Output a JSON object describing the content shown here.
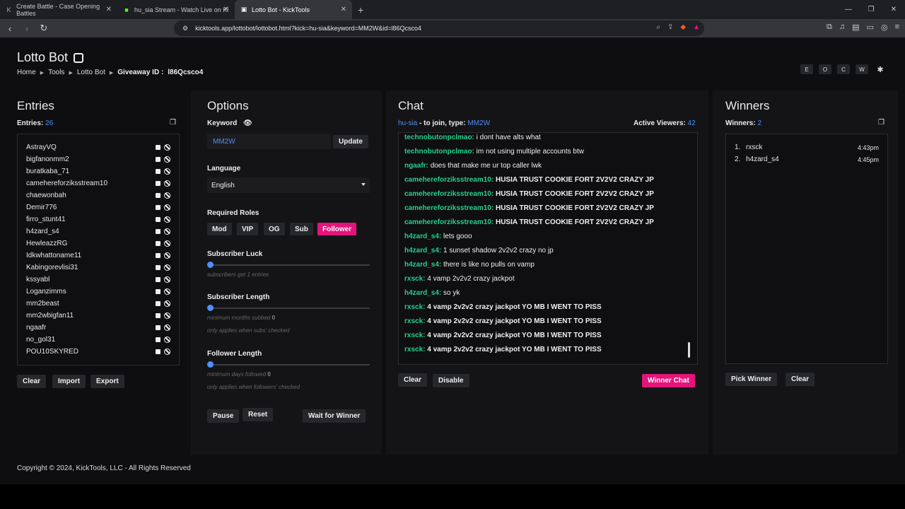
{
  "browser": {
    "tabs": [
      {
        "title": "Create Battle - Case Opening Battles",
        "icon": "k-logo-icon"
      },
      {
        "title": "hu_sia Stream - Watch Live on Ki",
        "icon": "kick-logo-icon"
      },
      {
        "title": "Lotto Bot - KickTools",
        "icon": "page-icon"
      }
    ],
    "url": "kicktools.app/lottobot/lottobot.html?kick=hu-sia&keyword=MM2W&id=l86Qcsco4"
  },
  "header": {
    "title": "Lotto Bot",
    "breadcrumb": [
      "Home",
      "Tools",
      "Lotto Bot"
    ],
    "giveaway_label": "Giveaway ID :",
    "giveaway_id": "l86Qcsco4",
    "theme_buttons": [
      "E",
      "O",
      "C",
      "W",
      "✱"
    ]
  },
  "entries": {
    "heading": "Entries",
    "count_label": "Entries:",
    "count": "26",
    "names": [
      "AstrayVQ",
      "bigfanonmm2",
      "buratkaba_71",
      "camehereforziksstream10",
      "chaewonbah",
      "Demir776",
      "firro_stunt41",
      "h4zard_s4",
      "HewleazzRG",
      "Idkwhattoname11",
      "Kabingorevlisi31",
      "kssyabl",
      "Loganzimms",
      "mm2beast",
      "mm2wbigfan11",
      "ngaafr",
      "no_gol31",
      "POU10SKYRED"
    ],
    "buttons": {
      "clear": "Clear",
      "import": "Import",
      "export": "Export"
    }
  },
  "options": {
    "heading": "Options",
    "keyword_label": "Keyword",
    "keyword_value": "MM2W",
    "update": "Update",
    "language_label": "Language",
    "language_value": "English",
    "roles_label": "Required Roles",
    "roles": [
      "Mod",
      "VIP",
      "OG",
      "Sub",
      "Follower"
    ],
    "sub_luck_label": "Subscriber Luck",
    "sub_luck_hint": "subscribers get 1 entries",
    "sub_length_label": "Subscriber Length",
    "sub_length_hint": "minimum months subbed",
    "sub_length_value": "0",
    "sub_length_hint2": "only applies when subs' checked",
    "follower_length_label": "Follower Length",
    "follower_length_hint": "minimum days followed",
    "follower_length_value": "0",
    "follower_length_hint2": "only applies when followers' checked",
    "pause": "Pause",
    "reset": "Reset",
    "wait": "Wait for Winner"
  },
  "chat": {
    "heading": "Chat",
    "channel": "hu-sia",
    "join_text": "- to join, type:",
    "keyword": "MM2W",
    "viewers_label": "Active Viewers:",
    "viewers": "42",
    "messages": [
      {
        "user": "technobutonpclmao:",
        "text": "i dont have alts what",
        "bold": false
      },
      {
        "user": "technobutonpclmao:",
        "text": "im not using multiple accounts btw",
        "bold": false
      },
      {
        "user": "ngaafr:",
        "text": "does that make me ur top caller lwk",
        "bold": false
      },
      {
        "user": "camehereforziksstream10:",
        "text": "HUSIA TRUST COOKIE FORT 2V2V2 CRAZY JP",
        "bold": true
      },
      {
        "user": "camehereforziksstream10:",
        "text": "HUSIA TRUST COOKIE FORT 2V2V2 CRAZY JP",
        "bold": true
      },
      {
        "user": "camehereforziksstream10:",
        "text": "HUSIA TRUST COOKIE FORT 2V2V2 CRAZY JP",
        "bold": true
      },
      {
        "user": "camehereforziksstream10:",
        "text": "HUSIA TRUST COOKIE FORT 2V2V2 CRAZY JP",
        "bold": true
      },
      {
        "user": "h4zard_s4:",
        "text": "lets gooo",
        "bold": false
      },
      {
        "user": "h4zard_s4:",
        "text": "1 sunset shadow 2v2v2 crazy no jp",
        "bold": false
      },
      {
        "user": "h4zard_s4:",
        "text": "there is like no pulls on vamp",
        "bold": false
      },
      {
        "user": "rxsck:",
        "text": "4 vamp 2v2v2 crazy jackpot",
        "bold": false
      },
      {
        "user": "h4zard_s4:",
        "text": "so yk",
        "bold": false
      },
      {
        "user": "rxsck:",
        "text": "4 vamp 2v2v2 crazy jackpot YO MB I WENT TO PISS",
        "bold": true
      },
      {
        "user": "rxsck:",
        "text": "4 vamp 2v2v2 crazy jackpot YO MB I WENT TO PISS",
        "bold": true
      },
      {
        "user": "rxsck:",
        "text": "4 vamp 2v2v2 crazy jackpot YO MB I WENT TO PISS",
        "bold": true
      },
      {
        "user": "rxsck:",
        "text": "4 vamp 2v2v2 crazy jackpot YO MB I WENT TO PISS",
        "bold": true
      }
    ],
    "clear": "Clear",
    "disable": "Disable",
    "winner_chat": "Winner Chat"
  },
  "winners": {
    "heading": "Winners",
    "count_label": "Winners:",
    "count": "2",
    "list": [
      {
        "rank": "1.",
        "name": "rxsck",
        "time": "4:43pm"
      },
      {
        "rank": "2.",
        "name": "h4zard_s4",
        "time": "4:45pm"
      }
    ],
    "pick": "Pick Winner",
    "clear": "Clear"
  },
  "footer": "Copyright © 2024, KickTools, LLC - All Rights Reserved",
  "colors": {
    "accent": "#4f8ff7",
    "pink": "#e4147a",
    "chat_user": "#23d18b"
  }
}
